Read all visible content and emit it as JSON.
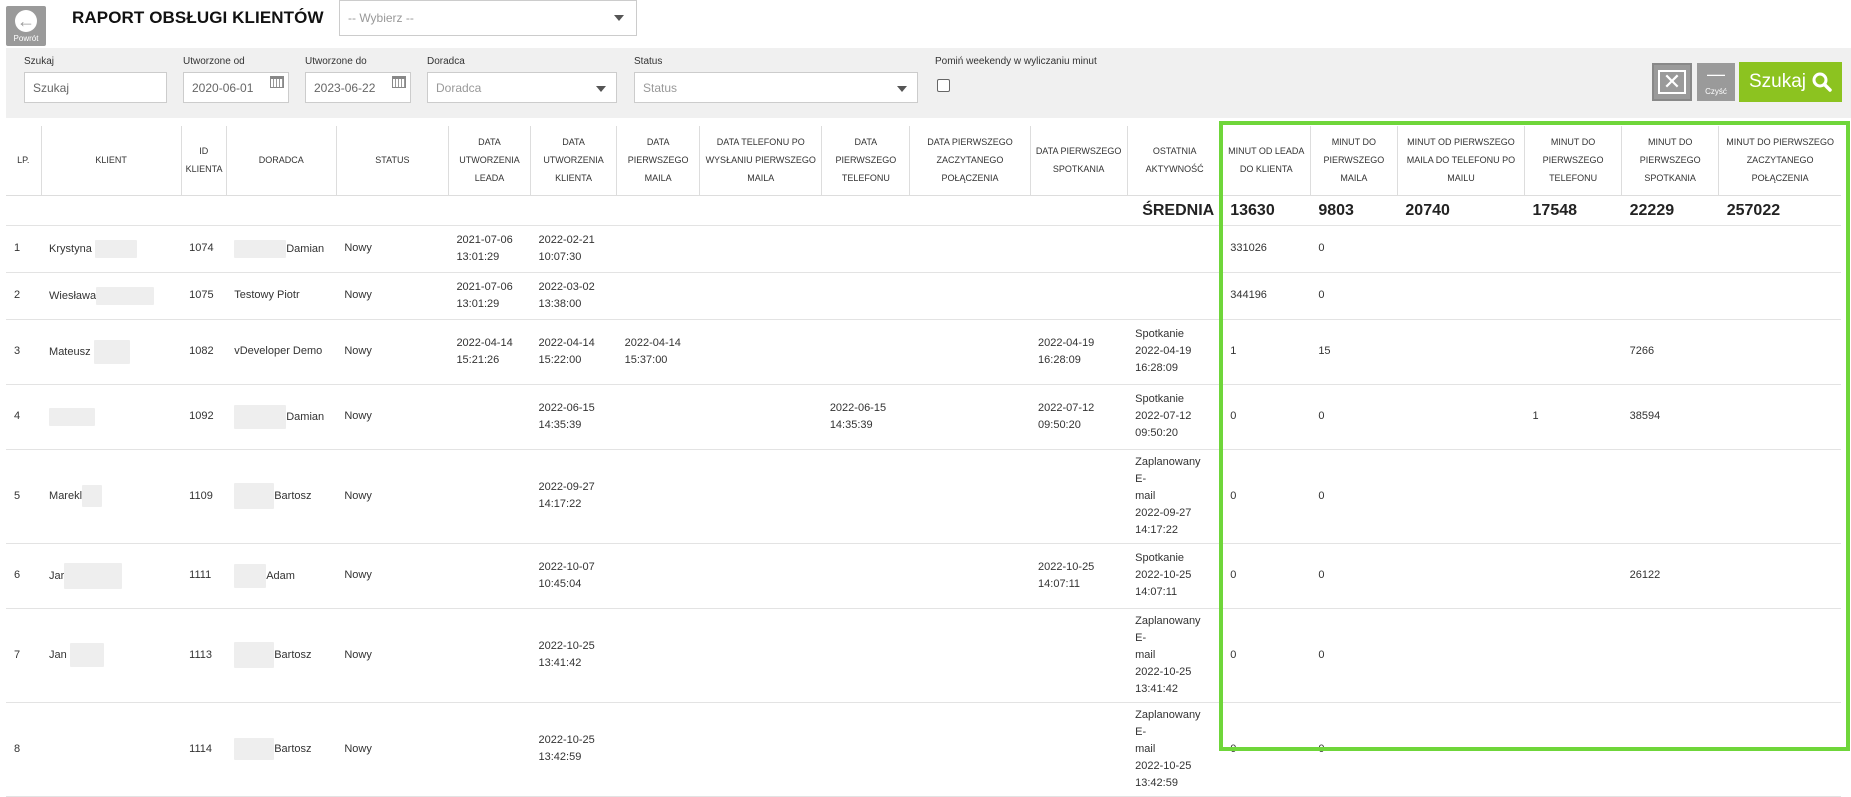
{
  "header": {
    "back_label": "Powrót",
    "title": "RAPORT OBSŁUGI KLIENTÓW",
    "select_placeholder": "-- Wybierz --"
  },
  "filters": {
    "search_label": "Szukaj",
    "search_placeholder": "Szukaj",
    "created_from_label": "Utworzone od",
    "created_from_value": "2020-06-01",
    "created_to_label": "Utworzone do",
    "created_to_value": "2023-06-22",
    "advisor_label": "Doradca",
    "advisor_placeholder": "Doradca",
    "status_label": "Status",
    "status_placeholder": "Status",
    "weekend_label": "Pomiń weekendy w wyliczaniu minut",
    "clear_label": "Czyść",
    "search_button": "Szukaj"
  },
  "table": {
    "headers": {
      "lp": "LP.",
      "client": "KLIENT",
      "client_id": "ID KLIENTA",
      "advisor": "DORADCA",
      "status": "STATUS",
      "lead_date": "DATA UTWORZENIA LEADA",
      "client_date": "DATA UTWORZENIA KLIENTA",
      "first_mail": "DATA PIERWSZEGO MAILA",
      "phone_after_mail": "DATA TELEFONU PO WYSŁANIU PIERWSZEGO MAILA",
      "first_phone": "DATA PIERWSZEGO TELEFONU",
      "first_read_conn": "DATA PIERWSZEGO ZACZYTANEGO POŁĄCZENIA",
      "first_meeting": "DATA PIERWSZEGO SPOTKANIA",
      "last_activity": "OSTATNIA AKTYWNOŚĆ",
      "min_lead_client": "MINUT OD LEADA DO KLIENTA",
      "min_first_mail": "MINUT DO PIERWSZEGO MAILA",
      "min_mail_phone": "MINUT OD PIERWSZEGO MAILA DO TELEFONU PO MAILU",
      "min_first_phone": "MINUT DO PIERWSZEGO TELEFONU",
      "min_first_meeting": "MINUT DO PIERWSZEGO SPOTKANIA",
      "min_first_read_conn": "MINUT DO PIERWSZEGO ZACZYTANEGO POŁĄCZENIA"
    },
    "average": {
      "label": "ŚREDNIA",
      "v1": "13630",
      "v2": "9803",
      "v3": "20740",
      "v4": "17548",
      "v5": "22229",
      "v6": "257022"
    },
    "rows": [
      {
        "lp": "1",
        "client": "Krystyna",
        "id": "1074",
        "advisor": "Damian",
        "status": "Nowy",
        "lead_date": "2021-07-06",
        "lead_time": "13:01:29",
        "client_date": "2022-02-21",
        "client_time": "10:07:30",
        "m1": "331026",
        "m2": "0"
      },
      {
        "lp": "2",
        "client": "Wiesława",
        "id": "1075",
        "advisor": "Testowy Piotr",
        "status": "Nowy",
        "lead_date": "2021-07-06",
        "lead_time": "13:01:29",
        "client_date": "2022-03-02",
        "client_time": "13:38:00",
        "m1": "344196",
        "m2": "0"
      },
      {
        "lp": "3",
        "client": "Mateusz",
        "id": "1082",
        "advisor": "vDeveloper Demo",
        "status": "Nowy",
        "lead_date": "2022-04-14",
        "lead_time": "15:21:26",
        "client_date": "2022-04-14",
        "client_time": "15:22:00",
        "mail_date": "2022-04-14",
        "mail_time": "15:37:00",
        "meet_date": "2022-04-19",
        "meet_time": "16:28:09",
        "act1": "Spotkanie",
        "act2": "2022-04-19",
        "act3": "16:28:09",
        "m1": "1",
        "m2": "15",
        "m5": "7266"
      },
      {
        "lp": "4",
        "client": "",
        "id": "1092",
        "advisor": "Damian",
        "status": "Nowy",
        "client_date": "2022-06-15",
        "client_time": "14:35:39",
        "phone_date": "2022-06-15",
        "phone_time": "14:35:39",
        "meet_date": "2022-07-12",
        "meet_time": "09:50:20",
        "act1": "Spotkanie",
        "act2": "2022-07-12",
        "act3": "09:50:20",
        "m1": "0",
        "m2": "0",
        "m4": "1",
        "m5": "38594"
      },
      {
        "lp": "5",
        "client": "Marekl",
        "id": "1109",
        "advisor": "Bartosz",
        "status": "Nowy",
        "client_date": "2022-09-27",
        "client_time": "14:17:22",
        "act1": "Zaplanowany E-",
        "act1b": "mail",
        "act2": "2022-09-27",
        "act3": "14:17:22",
        "m1": "0",
        "m2": "0"
      },
      {
        "lp": "6",
        "client": "Jar",
        "id": "1111",
        "advisor": "Adam",
        "status": "Nowy",
        "client_date": "2022-10-07",
        "client_time": "10:45:04",
        "meet_date": "2022-10-25",
        "meet_time": "14:07:11",
        "act1": "Spotkanie",
        "act2": "2022-10-25",
        "act3": "14:07:11",
        "m1": "0",
        "m2": "0",
        "m5": "26122"
      },
      {
        "lp": "7",
        "client": "Jan",
        "id": "1113",
        "advisor": "Bartosz",
        "status": "Nowy",
        "client_date": "2022-10-25",
        "client_time": "13:41:42",
        "act1": "Zaplanowany E-",
        "act1b": "mail",
        "act2": "2022-10-25",
        "act3": "13:41:42",
        "m1": "0",
        "m2": "0"
      },
      {
        "lp": "8",
        "client": "",
        "id": "1114",
        "advisor": "Bartosz",
        "status": "Nowy",
        "client_date": "2022-10-25",
        "client_time": "13:42:59",
        "act1": "Zaplanowany E-",
        "act1b": "mail",
        "act2": "2022-10-25",
        "act3": "13:42:59",
        "m1": "0",
        "m2": "0"
      }
    ]
  },
  "colors": {
    "accent_green": "#8cc320",
    "highlight_border": "#6fd63a",
    "button_gray": "#9a9a9a"
  }
}
